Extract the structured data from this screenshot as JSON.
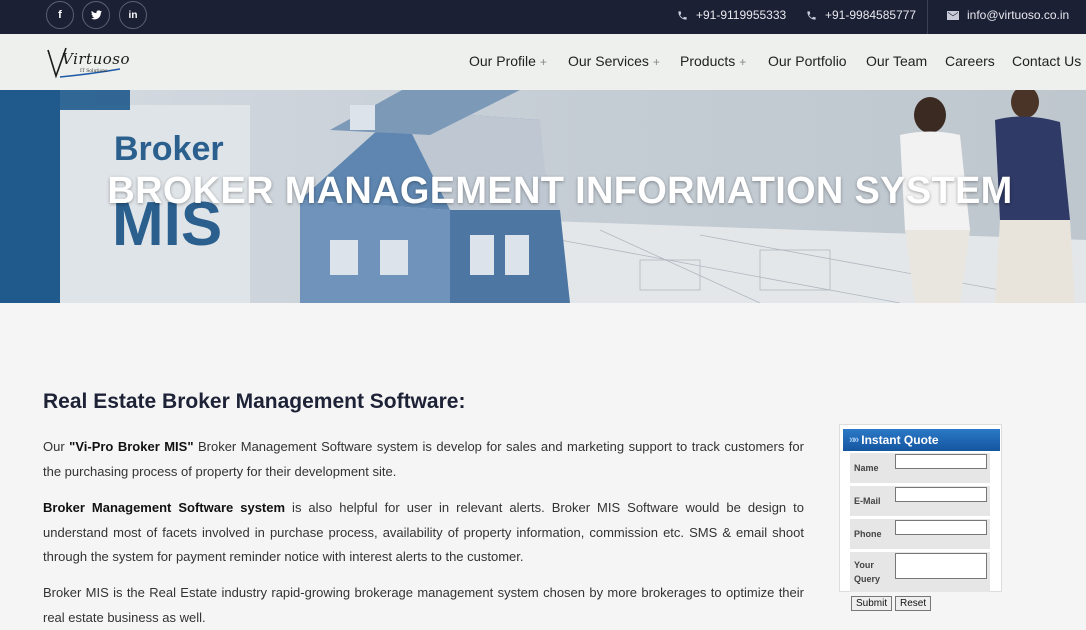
{
  "topbar": {
    "social": [
      {
        "name": "facebook-icon",
        "glyph": "f"
      },
      {
        "name": "twitter-icon",
        "glyph": "t"
      },
      {
        "name": "linkedin-icon",
        "glyph": "in"
      }
    ],
    "phone1": "+91-9119955333",
    "phone2": "+91-9984585777",
    "email": "info@virtuoso.co.in"
  },
  "logo": {
    "text": "Virtuoso",
    "sub": "IT Solutions"
  },
  "nav": {
    "profile": "Our Profile",
    "services": "Our Services",
    "products": "Products",
    "portfolio": "Our Portfolio",
    "team": "Our Team",
    "careers": "Careers",
    "contact": "Contact Us",
    "plus": "+"
  },
  "hero": {
    "title": "BROKER MANAGEMENT INFORMATION SYSTEM",
    "sign_line1": "Broker",
    "sign_line2": "MIS"
  },
  "content": {
    "heading": "Real Estate Broker Management Software:",
    "p1_pre": "Our ",
    "p1_bold": "\"Vi-Pro Broker MIS\"",
    "p1_post": " Broker Management Software system is develop for sales and marketing support to track customers for the purchasing process of property for their development site.",
    "p2_bold": "Broker Management Software system",
    "p2_post": " is also helpful for user in relevant alerts. Broker MIS Software would be design to understand most of facets involved in purchase process, availability of property information, commission etc. SMS & email shoot through the system for payment reminder notice with interest alerts to the customer.",
    "p3": "Broker MIS is the Real Estate industry rapid-growing brokerage management system chosen by more brokerages to optimize their real estate business as well."
  },
  "quote": {
    "title": "Instant Quote",
    "name_label": "Name",
    "email_label": "E-Mail",
    "phone_label": "Phone",
    "query_label1": "Your",
    "query_label2": "Query",
    "submit": "Submit",
    "reset": "Reset"
  },
  "colors": {
    "topbar": "#1b2035",
    "navbar": "#edf0ec",
    "heading": "#1d2236",
    "quote_header": "#1f68b4"
  }
}
